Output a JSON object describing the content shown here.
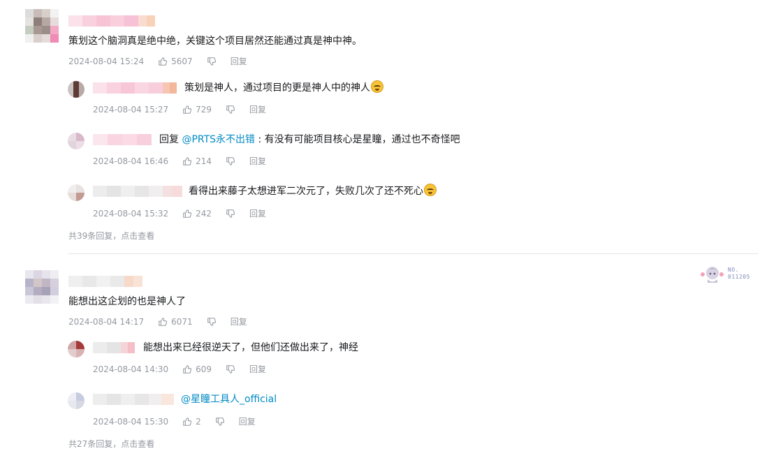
{
  "icons": {
    "like": "thumbs-up-icon",
    "dislike": "thumbs-down-icon"
  },
  "colors": {
    "mention": "#008ac5",
    "meta": "#9499a0",
    "divider": "#e3e5e7"
  },
  "comments": [
    {
      "text": "策划这个脑洞真是绝中绝，关键这个项目居然还能通过真是神中神。",
      "time": "2024-08-04 15:24",
      "likes": "5607",
      "reply_label": "回复",
      "replies": [
        {
          "text": "策划是神人，通过项目的更是神人中的神人",
          "time": "2024-08-04 15:27",
          "likes": "729",
          "reply_label": "回复"
        },
        {
          "prefix": "回复 ",
          "mention": "@PRTS永不出错",
          "text": " : 有没有可能项目核心是星瞳，通过也不奇怪吧",
          "time": "2024-08-04 16:46",
          "likes": "214",
          "reply_label": "回复"
        },
        {
          "text": "看得出来藤子太想进军二次元了，失败几次了还不死心",
          "time": "2024-08-04 15:32",
          "likes": "242",
          "reply_label": "回复"
        }
      ],
      "more": {
        "count": "共39条回复，",
        "link": "点击查看"
      }
    },
    {
      "text": "能想出这企划的也是神人了",
      "time": "2024-08-04 14:17",
      "likes": "6071",
      "reply_label": "回复",
      "badge": {
        "no_label": "NO.",
        "number": "011205"
      },
      "replies": [
        {
          "text": "能想出来已经很逆天了，但他们还做出来了，神经",
          "time": "2024-08-04 14:30",
          "likes": "609",
          "reply_label": "回复"
        },
        {
          "mention": "@星瞳工具人_official",
          "time": "2024-08-04 15:30",
          "likes": "2",
          "reply_label": "回复"
        }
      ],
      "more": {
        "count": "共27条回复，",
        "link": "点击查看"
      }
    }
  ]
}
